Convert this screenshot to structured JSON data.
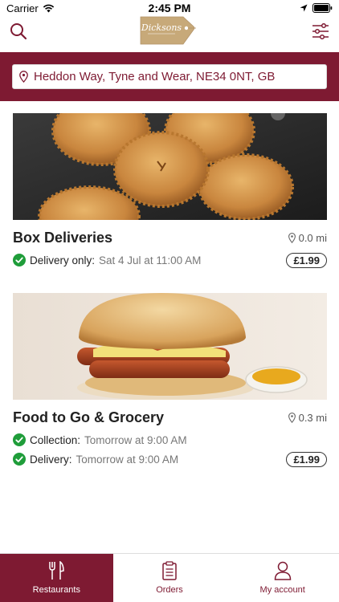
{
  "status_bar": {
    "carrier": "Carrier",
    "time": "2:45 PM"
  },
  "header": {
    "logo_text": "Dicksons",
    "search_icon": "search-icon",
    "filter_icon": "sliders-icon"
  },
  "location": {
    "address": "Heddon Way, Tyne and Wear, NE34 0NT, GB"
  },
  "restaurants": [
    {
      "name": "Box Deliveries",
      "distance": "0.0 mi",
      "image": "pies-photo",
      "options": [
        {
          "label": "Delivery only:",
          "value": "Sat 4 Jul at 11:00 AM"
        }
      ],
      "fee": "£1.99"
    },
    {
      "name": "Food to Go & Grocery",
      "distance": "0.3 mi",
      "image": "hotdog-photo",
      "options": [
        {
          "label": "Collection:",
          "value": "Tomorrow at 9:00 AM"
        },
        {
          "label": "Delivery:",
          "value": "Tomorrow at 9:00 AM"
        }
      ],
      "fee": "£1.99"
    }
  ],
  "tabs": [
    {
      "label": "Restaurants",
      "icon": "cutlery-icon",
      "active": true
    },
    {
      "label": "Orders",
      "icon": "clipboard-icon",
      "active": false
    },
    {
      "label": "My account",
      "icon": "person-icon",
      "active": false
    }
  ],
  "colors": {
    "brand": "#7e1a32",
    "check": "#1f9d3a"
  }
}
